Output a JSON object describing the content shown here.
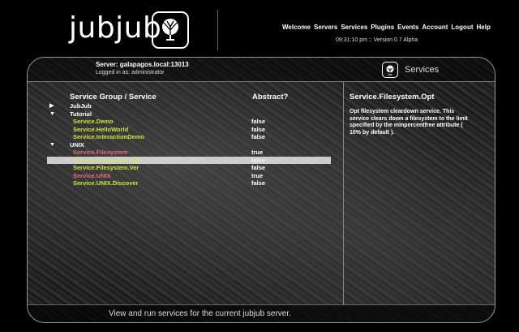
{
  "header": {
    "logo_text": "jubjub",
    "nav": [
      "Welcome",
      "Servers",
      "Services",
      "Plugins",
      "Events",
      "Account",
      "Logout",
      "Help"
    ],
    "version": "09:31:10 pm :: Version 0.7 Alpha"
  },
  "panel": {
    "server": "Server: galapagos.local:13013",
    "logged_in": "Logged in as: administrator",
    "section_title": "Services",
    "footer": "View and run services for the current jubjub server."
  },
  "table": {
    "col_service": "Service Group / Service",
    "col_abstract": "Abstract?",
    "rows": [
      {
        "kind": "group",
        "tri": "▶",
        "name": "JubJub",
        "value": ""
      },
      {
        "kind": "group",
        "tri": "▼",
        "name": "Tutorial",
        "value": ""
      },
      {
        "kind": "svc",
        "tri": "",
        "name": "Service.Demo",
        "value": "false"
      },
      {
        "kind": "svc",
        "tri": "",
        "name": "Service.HelloWorld",
        "value": "false"
      },
      {
        "kind": "svc",
        "tri": "",
        "name": "Service.InteractionDemo",
        "value": "false"
      },
      {
        "kind": "group",
        "tri": "▼",
        "name": "UNIX",
        "value": ""
      },
      {
        "kind": "svc-pink",
        "tri": "",
        "name": "Service.Filesystem",
        "value": "true"
      },
      {
        "kind": "svc-selected",
        "tri": "",
        "name": "Service.Filesystem.Opt",
        "value": "false"
      },
      {
        "kind": "svc",
        "tri": "",
        "name": "Service.Filesystem.Ver",
        "value": "false"
      },
      {
        "kind": "svc-pink",
        "tri": "",
        "name": "Service.UNIX",
        "value": "true"
      },
      {
        "kind": "svc",
        "tri": "",
        "name": "Service.UNIX.Discover",
        "value": "false"
      }
    ]
  },
  "detail": {
    "title": "Service.Filesystem.Opt",
    "description": "Opt filesystem cleardown service. This service clears down a filesystem to the limit specified by the minpercentfree attribute ( 10% by default )."
  },
  "colors": {
    "service_green": "#cfe23f",
    "abstract_pink": "#e56d7c",
    "selection": "#e6e6e6"
  },
  "icons": [
    "tree-logo-icon",
    "tree-services-icon",
    "expand-triangle-icon",
    "collapse-triangle-icon"
  ]
}
